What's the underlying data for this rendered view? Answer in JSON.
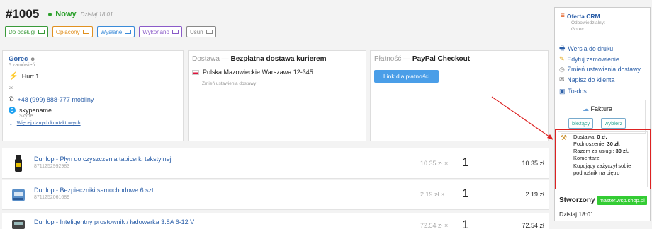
{
  "order": {
    "number": "#1005",
    "status": "Nowy",
    "date": "Dzisiaj 18:01"
  },
  "tags": [
    {
      "label": "Do obsługi",
      "color": "#3a9a3a"
    },
    {
      "label": "Opłacony",
      "color": "#e09020"
    },
    {
      "label": "Wysłane",
      "color": "#3a8ad8"
    },
    {
      "label": "Wykonano",
      "color": "#8a5ac8"
    },
    {
      "label": "Usuń",
      "color": "#888888"
    }
  ],
  "customer": {
    "name": "Gorec",
    "orders": "5 zamówień",
    "group": "Hurt 1",
    "email": ". .",
    "phone": "+48 (999) 888-777 mobilny",
    "skype": "skypename",
    "skype_label": "Skype",
    "more_link": "Więcej danych kontaktowych"
  },
  "delivery": {
    "title_prefix": "Dostawa —",
    "title_method": "Bezpłatna dostawa kurierem",
    "address": "Polska Mazowieckie Warszawa 12-345",
    "change_link": "Zmień ustawienia dostawy"
  },
  "payment": {
    "title_prefix": "Płatność —",
    "title_method": "PayPal Checkout",
    "button": "Link dla płatności"
  },
  "products": [
    {
      "name": "Dunlop - Płyn do czyszczenia tapicerki tekstylnej",
      "code": "8711252992983",
      "price": "10.35 zł ×",
      "qty": "1",
      "total": "10.35 zł"
    },
    {
      "name": "Dunlop - Bezpieczniki samochodowe 6 szt.",
      "code": "8711252061689",
      "price": "2.19 zł ×",
      "qty": "1",
      "total": "2.19 zł"
    },
    {
      "name": "Dunlop - Inteligentny prostownik / ładowarka 3.8A 6-12 V",
      "code": "",
      "price": "72.54 zł ×",
      "qty": "1",
      "total": "72.54 zł"
    }
  ],
  "sidebar": {
    "offer_title": "Oferta CRM",
    "responsible_label": "Odpowiedzialny:",
    "responsible_name": "Gorec",
    "actions": [
      "Wersja do druku",
      "Edytuj zamówienie",
      "Zmień ustawienia dostawy",
      "Napisz do klienta",
      "To-dos"
    ],
    "invoice_title": "Faktura",
    "invoice_current": "bieżący",
    "invoice_choose": "wybierz",
    "services": {
      "delivery_label": "Dostawa:",
      "delivery_value": "0 zł.",
      "lift_label": "Podnoszenie:",
      "lift_value": "30 zł.",
      "total_label": "Razem za usługi:",
      "total_value": "30 zł.",
      "comment_label": "Komentarz:",
      "comment": "Kupujący zażyczył sobie podnośnik na piętro"
    },
    "created_label": "Stworzony",
    "created_by": "master.wsp.shop.pl",
    "created_date": "Dzisiaj 18:01"
  },
  "colors": {
    "accent": "#2a5ea8",
    "success": "#2ba02b",
    "highlight": "#dd2222",
    "pay_button": "#4a9ee8"
  }
}
